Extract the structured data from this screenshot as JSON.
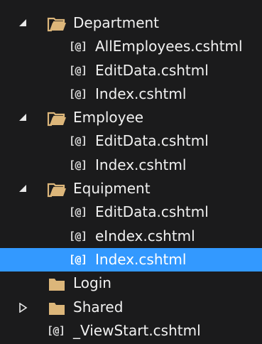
{
  "tree": {
    "folders": [
      {
        "label": "Department",
        "state": "expanded",
        "files": [
          {
            "label": "AllEmployees.cshtml",
            "icon": "razor-file-icon"
          },
          {
            "label": "EditData.cshtml",
            "icon": "razor-file-icon"
          },
          {
            "label": "Index.cshtml",
            "icon": "razor-file-icon"
          }
        ]
      },
      {
        "label": "Employee",
        "state": "expanded",
        "files": [
          {
            "label": "EditData.cshtml",
            "icon": "razor-file-icon"
          },
          {
            "label": "Index.cshtml",
            "icon": "razor-file-icon"
          }
        ]
      },
      {
        "label": "Equipment",
        "state": "expanded",
        "files": [
          {
            "label": "EditData.cshtml",
            "icon": "razor-file-icon"
          },
          {
            "label": "eIndex.cshtml",
            "icon": "razor-file-icon"
          },
          {
            "label": "Index.cshtml",
            "icon": "razor-file-icon",
            "selected": true
          }
        ]
      },
      {
        "label": "Login",
        "state": "no-children",
        "files": []
      },
      {
        "label": "Shared",
        "state": "collapsed",
        "files": []
      }
    ],
    "root_files": [
      {
        "label": "_ViewStart.cshtml",
        "icon": "razor-file-icon"
      }
    ],
    "file_icon_glyph": "[@]"
  },
  "colors": {
    "background": "#1b1b1c",
    "text": "#f1f1f1",
    "selection": "#3399ff",
    "folder": "#dcb67a"
  }
}
